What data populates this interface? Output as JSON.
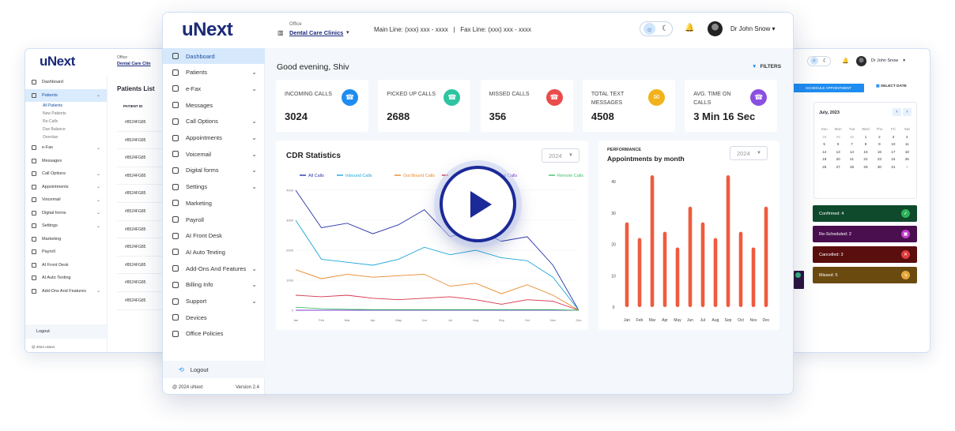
{
  "back_left": {
    "logo": "uNext",
    "office_label": "Office",
    "office_value": "Dental Care Clin",
    "nav": [
      "Dashboard",
      "Patients",
      "e-Fax",
      "Messages",
      "Call Options",
      "Appointments",
      "Voicemail",
      "Digital forms",
      "Settings",
      "Marketing",
      "Payroll",
      "AI Front Desk",
      "AI Auto Texting",
      "Add-Ons And Features"
    ],
    "sub_nav": [
      "All Patients",
      "New Patients",
      "Re-Calls",
      "Due Balance",
      "Overdue"
    ],
    "logout": "Logout",
    "footer_left": "@ 2024 uNext",
    "footer_right": "Version 2.4",
    "patients_title": "Patients List",
    "patient_id_header": "PATIENT ID",
    "patient_ids": [
      "#8524FG85",
      "#8524FG85",
      "#8524FG85",
      "#8524FG85",
      "#8524FG85",
      "#8524FG85",
      "#8524FG85",
      "#8524FG85",
      "#8524FG85",
      "#8524FG85",
      "#8524FG85"
    ]
  },
  "back_right": {
    "user": "Dr John Snow",
    "schedule_button": "SCHEDULE APPOINTMENT",
    "select_date": "SELECT DATE",
    "calendar_title": "July, 2023",
    "weekdays": [
      "Sun",
      "Mon",
      "Tue",
      "Wed",
      "Thu",
      "Fri",
      "Sat"
    ],
    "days": [
      "28",
      "29",
      "30",
      "1",
      "2",
      "3",
      "4",
      "5",
      "6",
      "7",
      "8",
      "9",
      "10",
      "11",
      "12",
      "13",
      "14",
      "15",
      "16",
      "17",
      "18",
      "19",
      "20",
      "21",
      "22",
      "23",
      "24",
      "25",
      "26",
      "27",
      "28",
      "29",
      "30",
      "31",
      "1"
    ],
    "selected_day": "14",
    "statuses": [
      {
        "label": "Confirmed: 4",
        "color": "#0f4a2c",
        "icon_color": "#2db35a",
        "icon": "✓"
      },
      {
        "label": "Re-Scheduled: 2",
        "color": "#4a0f4f",
        "icon_color": "#c13bc8",
        "icon": "▣"
      },
      {
        "label": "Cancelled: 3",
        "color": "#5a0e0e",
        "icon_color": "#e23c3c",
        "icon": "✕"
      },
      {
        "label": "Missed: 5",
        "color": "#6b4a10",
        "icon_color": "#e6a73a",
        "icon": "↘"
      }
    ]
  },
  "main": {
    "logo": "uNext",
    "office_label": "Office",
    "office_value": "Dental Care Clinics",
    "phone_lines": "Main Line: (xxx) xxx - xxxx   |   Fax Line: (xxx) xxx - xxxx",
    "user": "Dr John Snow",
    "nav": [
      {
        "label": "Dashboard",
        "chev": false
      },
      {
        "label": "Patients",
        "chev": true
      },
      {
        "label": "e-Fax",
        "chev": true
      },
      {
        "label": "Messages",
        "chev": false
      },
      {
        "label": "Call Options",
        "chev": true
      },
      {
        "label": "Appointments",
        "chev": true
      },
      {
        "label": "Voicemail",
        "chev": true
      },
      {
        "label": "Digital forms",
        "chev": true
      },
      {
        "label": "Settings",
        "chev": true
      },
      {
        "label": "Marketing",
        "chev": false
      },
      {
        "label": "Payroll",
        "chev": false
      },
      {
        "label": "AI Front Desk",
        "chev": false
      },
      {
        "label": "AI Auto Texting",
        "chev": false
      },
      {
        "label": "Add-Ons And Features",
        "chev": true
      },
      {
        "label": "Billing Info",
        "chev": true
      },
      {
        "label": "Support",
        "chev": true
      },
      {
        "label": "Devices",
        "chev": false
      },
      {
        "label": "Office Policies",
        "chev": false
      }
    ],
    "logout": "Logout",
    "footer_left": "@ 2024 uNext",
    "footer_right": "Version 2.4",
    "greeting": "Good evening, Shiv",
    "filters": "FILTERS",
    "stats": [
      {
        "label": "INCOMING CALLS",
        "value": "3024",
        "color": "#1e8cf0",
        "icon": "☎"
      },
      {
        "label": "PICKED UP CALLS",
        "value": "2688",
        "color": "#2ec4a0",
        "icon": "☎"
      },
      {
        "label": "MISSED CALLS",
        "value": "356",
        "color": "#ea4b4b",
        "icon": "☎"
      },
      {
        "label": "TOTAL TEXT MESSAGES",
        "value": "4508",
        "color": "#f2b21b",
        "icon": "✉"
      },
      {
        "label": "AVG. TIME ON CALLS",
        "value": "3 Min 16 Sec",
        "color": "#8a4fe0",
        "icon": "☎"
      }
    ],
    "cdr_title": "CDR Statistics",
    "year_select": "2024",
    "perf_kicker": "PERFORMANCE",
    "perf_title": "Appointments by month",
    "perf_year": "2024"
  },
  "chart_data": [
    {
      "type": "line",
      "title": "CDR Statistics",
      "x": [
        "Jan",
        "Feb",
        "Mar",
        "Apr",
        "May",
        "Jun",
        "Jul",
        "Aug",
        "Sep",
        "Oct",
        "Nov",
        "Dec"
      ],
      "ylim": [
        0,
        4000
      ],
      "yticks": [
        0,
        1000,
        2000,
        3000,
        4000
      ],
      "legend": "top",
      "series": [
        {
          "name": "All Calls",
          "color": "#2a35a8",
          "values": [
            4000,
            2750,
            2900,
            2550,
            2850,
            3350,
            2450,
            2700,
            2300,
            2450,
            1500,
            0
          ]
        },
        {
          "name": "Inbound Calls",
          "color": "#1fa8d8",
          "values": [
            3000,
            1700,
            1600,
            1500,
            1700,
            2100,
            1850,
            2000,
            1750,
            1650,
            1100,
            0
          ]
        },
        {
          "name": "Out Bound Calls",
          "color": "#e8892a",
          "values": [
            1350,
            1050,
            1200,
            1100,
            1150,
            1200,
            800,
            900,
            550,
            850,
            500,
            0
          ]
        },
        {
          "name": "",
          "color": "#d6334a",
          "values": [
            500,
            450,
            500,
            400,
            350,
            400,
            450,
            350,
            200,
            350,
            300,
            0
          ]
        },
        {
          "name": "Internal Calls",
          "color": "#7a3fcf",
          "values": [
            0,
            0,
            0,
            0,
            0,
            0,
            0,
            0,
            0,
            0,
            0,
            0
          ]
        },
        {
          "name": "Remote Calls",
          "color": "#3ec26a",
          "values": [
            100,
            50,
            30,
            20,
            20,
            20,
            20,
            20,
            20,
            20,
            20,
            0
          ]
        }
      ]
    },
    {
      "type": "bar",
      "title": "Appointments by month",
      "categories": [
        "Jan",
        "Feb",
        "Mar",
        "Apr",
        "May",
        "Jun",
        "Jul",
        "Aug",
        "Sep",
        "Oct",
        "Nov",
        "Dec"
      ],
      "ylim": [
        0,
        40
      ],
      "yticks": [
        0,
        10,
        20,
        30,
        40
      ],
      "color": "#ef5b3e",
      "pairs": [
        [
          27,
          22
        ],
        [
          42,
          24
        ],
        [
          19,
          32
        ],
        [
          27,
          22
        ],
        [
          42,
          24
        ],
        [
          19,
          32
        ]
      ],
      "values": [
        27,
        22,
        42,
        24,
        19,
        32,
        27,
        22,
        42,
        24,
        19,
        32
      ]
    }
  ]
}
